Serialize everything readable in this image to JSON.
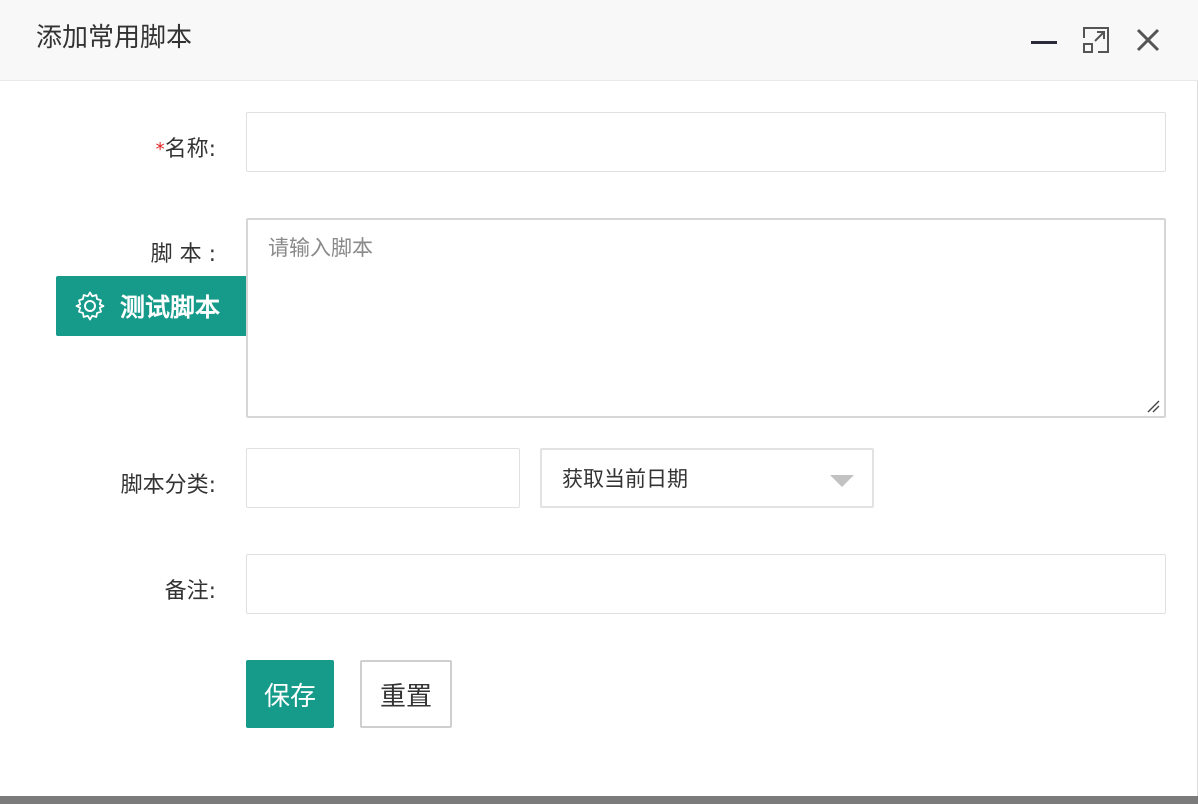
{
  "dialog": {
    "title": "添加常用脚本",
    "minimize_icon": "minimize-icon",
    "maximize_icon": "maximize-icon",
    "close_icon": "close-icon"
  },
  "form": {
    "name": {
      "required_mark": "*",
      "label": "名称:",
      "value": ""
    },
    "script": {
      "label": "脚 本 :",
      "placeholder": "请输入脚本",
      "value": "",
      "test_button_label": "测试脚本",
      "test_icon": "gear-icon"
    },
    "category": {
      "label": "脚本分类:",
      "value": "",
      "select_value": "获取当前日期"
    },
    "remark": {
      "label": "备注:",
      "value": ""
    }
  },
  "actions": {
    "save_label": "保存",
    "reset_label": "重置"
  },
  "colors": {
    "primary": "#169a8a",
    "required": "#e02020"
  }
}
